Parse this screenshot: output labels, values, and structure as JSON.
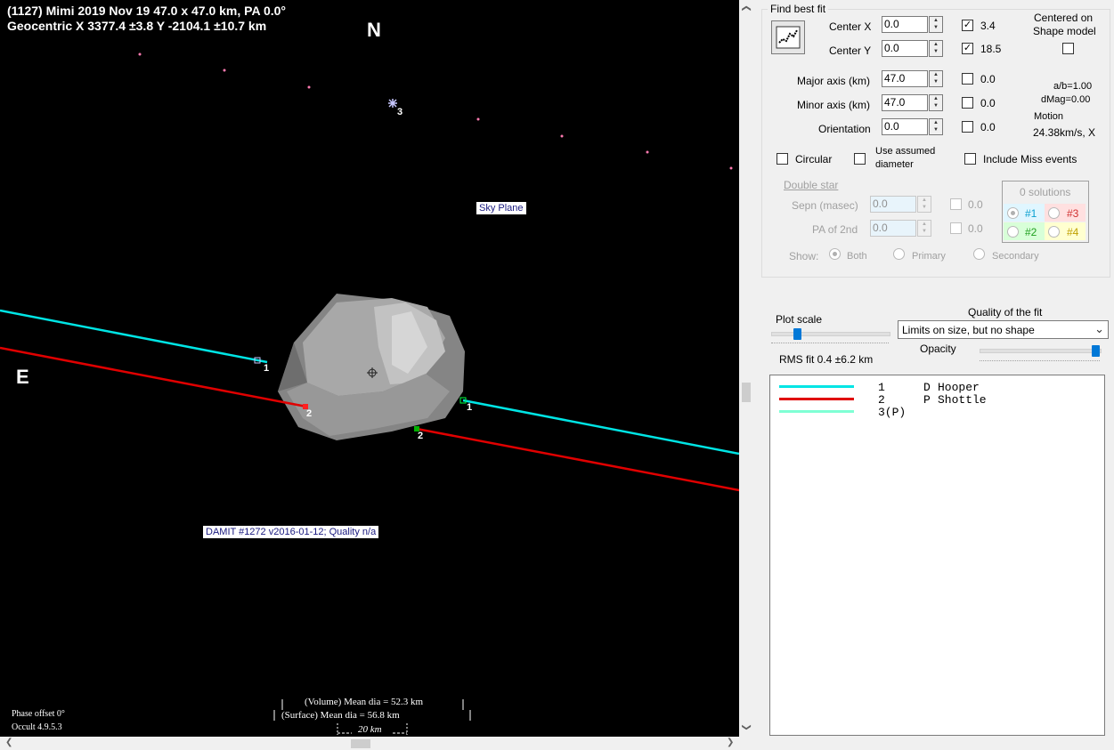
{
  "plot": {
    "title_line1": "(1127) Mimi  2019 Nov 19  47.0 x 47.0 km, PA 0.0°",
    "title_line2": "Geocentric  X  3377.4 ±3.8  Y -2104.1 ±10.7 km",
    "north_label": "N",
    "east_label": "E",
    "sky_plane_label": "Sky Plane",
    "damit_label": "DAMIT #1272 v2016-01-12; Quality n/a",
    "volume_dia": "(Volume) Mean dia = 52.3 km",
    "surface_dia": "(Surface) Mean dia = 56.8 km",
    "scale_bar": "20 km",
    "phase_offset": "Phase offset 0°",
    "version": "Occult 4.9.5.3",
    "chord_labels": {
      "c1a": "1",
      "c1b": "1",
      "c2a": "2",
      "c2b": "2",
      "star3": "3"
    },
    "colors": {
      "chord1": "#00e5e5",
      "chord2": "#e00000",
      "chord3": "#7fffd4",
      "background": "#000000"
    }
  },
  "panel": {
    "find_best_fit": "Find best fit",
    "center_x_label": "Center X",
    "center_x_value": "0.0",
    "center_y_label": "Center Y",
    "center_y_value": "0.0",
    "center_x_unc": "3.4",
    "center_y_unc": "18.5",
    "centered_on": "Centered on",
    "shape_model": "Shape model",
    "major_label": "Major axis (km)",
    "major_value": "47.0",
    "major_unc": "0.0",
    "minor_label": "Minor axis (km)",
    "minor_value": "47.0",
    "minor_unc": "0.0",
    "orient_label": "Orientation",
    "orient_value": "0.0",
    "orient_unc": "0.0",
    "ab_ratio": "a/b=1.00",
    "dmag": "dMag=0.00",
    "motion_label": "Motion",
    "motion_value": "24.38km/s, X",
    "circular": "Circular",
    "use_assumed_1": "Use assumed",
    "use_assumed_2": "diameter",
    "include_miss": "Include Miss events",
    "double_star": "Double star",
    "sepn_label": "Sepn (masec)",
    "sepn_value": "0.0",
    "sepn_unc": "0.0",
    "pa2_label": "PA of 2nd",
    "pa2_value": "0.0",
    "pa2_unc": "0.0",
    "solutions": "0 solutions",
    "sol1": "#1",
    "sol2": "#2",
    "sol3": "#3",
    "sol4": "#4",
    "show_label": "Show:",
    "show_both": "Both",
    "show_primary": "Primary",
    "show_secondary": "Secondary",
    "quality_label": "Quality of the fit",
    "quality_value": "Limits on size, but no shape",
    "plot_scale": "Plot scale",
    "opacity": "Opacity",
    "rms_fit": "RMS fit 0.4 ±6.2 km",
    "plot_scale_level": 0.2,
    "opacity_level": 1.0
  },
  "legend": [
    {
      "num": "1",
      "code": "D",
      "name": "Hooper",
      "color": "#00e5e5"
    },
    {
      "num": "2",
      "code": "P",
      "name": "Shottle",
      "color": "#e00000"
    },
    {
      "num": "3(P)",
      "code": "",
      "name": "",
      "color": "#7fffd4"
    }
  ]
}
